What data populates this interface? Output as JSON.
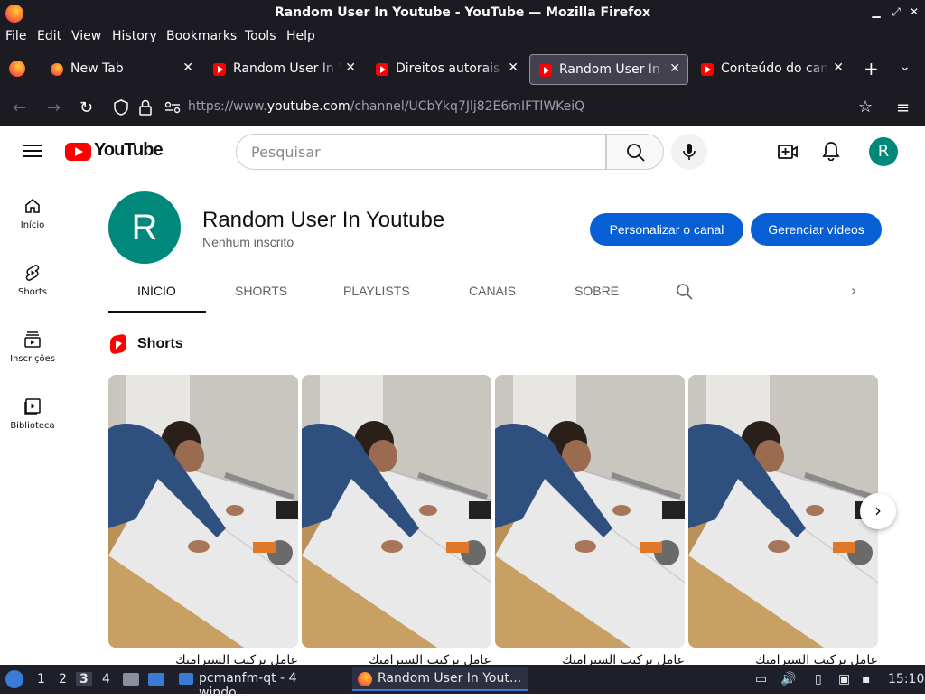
{
  "window": {
    "title": "Random User In Youtube - YouTube — Mozilla Firefox"
  },
  "menu": [
    "File",
    "Edit",
    "View",
    "History",
    "Bookmarks",
    "Tools",
    "Help"
  ],
  "tabs": [
    {
      "label": "New Tab",
      "active": false
    },
    {
      "label": "Random User In Youtube",
      "active": false
    },
    {
      "label": "Direitos autorais do canal",
      "active": false
    },
    {
      "label": "Random User In Youtube",
      "active": true
    },
    {
      "label": "Conteúdo do canal",
      "active": false
    }
  ],
  "address": {
    "prefix": "https://www.",
    "domain": "youtube.com",
    "path": "/channel/UCbYkq7Jlj82E6mIFTlWKeiQ"
  },
  "yt": {
    "logo_text": "YouTube",
    "search_placeholder": "Pesquisar",
    "avatar_letter": "R",
    "sidebar": [
      {
        "label": "Início",
        "icon": "home-icon"
      },
      {
        "label": "Shorts",
        "icon": "shorts-icon"
      },
      {
        "label": "Inscrições",
        "icon": "subscriptions-icon"
      },
      {
        "label": "Biblioteca",
        "icon": "library-icon"
      }
    ],
    "channel": {
      "letter": "R",
      "name": "Random User In Youtube",
      "subscribers": "Nenhum inscrito",
      "customize_label": "Personalizar o canal",
      "manage_label": "Gerenciar vídeos"
    },
    "channel_tabs": [
      "INÍCIO",
      "SHORTS",
      "PLAYLISTS",
      "CANAIS",
      "SOBRE"
    ],
    "shorts_heading": "Shorts",
    "shorts": [
      {
        "caption": "عامل تركيب السيراميك"
      },
      {
        "caption": "عامل تركيب السيراميك"
      },
      {
        "caption": "عامل تركيب السيراميك"
      },
      {
        "caption": "عامل تركيب السيراميك"
      }
    ]
  },
  "taskbar": {
    "desktops": [
      "1",
      "2",
      "3",
      "4"
    ],
    "active_desktop": "3",
    "windows": [
      {
        "label": "pcmanfm-qt - 4 windo...",
        "active": false
      },
      {
        "label": "Random User In Yout...",
        "active": true
      }
    ],
    "clock": "15:10"
  }
}
